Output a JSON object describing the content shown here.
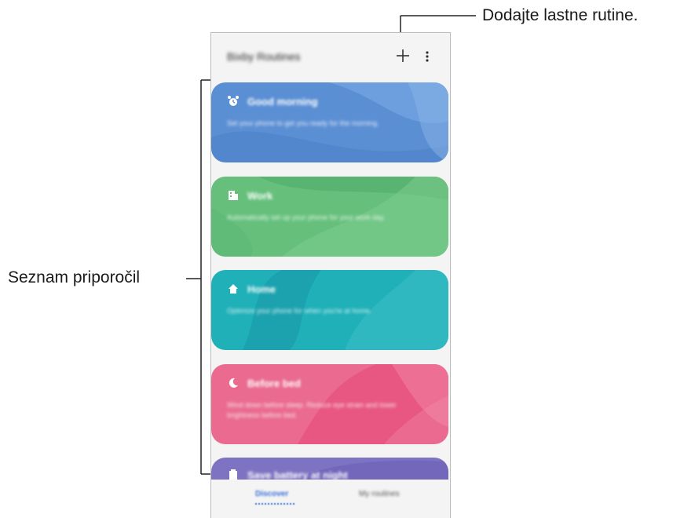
{
  "annotations": {
    "add_routine_callout": "Dodajte lastne rutine.",
    "recommendations_callout": "Seznam priporočil"
  },
  "appbar": {
    "title": "Bixby Routines",
    "add_icon": "plus-icon",
    "more_icon": "more-vert-icon"
  },
  "routines": [
    {
      "title": "Good morning",
      "description": "Set your phone to get you ready for the morning.",
      "icon": "alarm-clock-icon",
      "color": "#5a8fd6"
    },
    {
      "title": "Work",
      "description": "Automatically set up your phone for your work day.",
      "icon": "building-icon",
      "color": "#66c07c"
    },
    {
      "title": "Home",
      "description": "Optimize your phone for when you're at home.",
      "icon": "home-icon",
      "color": "#1fb0b8"
    },
    {
      "title": "Before bed",
      "description": "Wind down before sleep. Reduce eye strain and lower brightness before bed.",
      "icon": "moon-icon",
      "color": "#ea5c86"
    },
    {
      "title": "Save battery at night",
      "description": "",
      "icon": "battery-icon",
      "color": "#7e73c2"
    }
  ],
  "tabs": {
    "discover": "Discover",
    "my_routines": "My routines"
  }
}
